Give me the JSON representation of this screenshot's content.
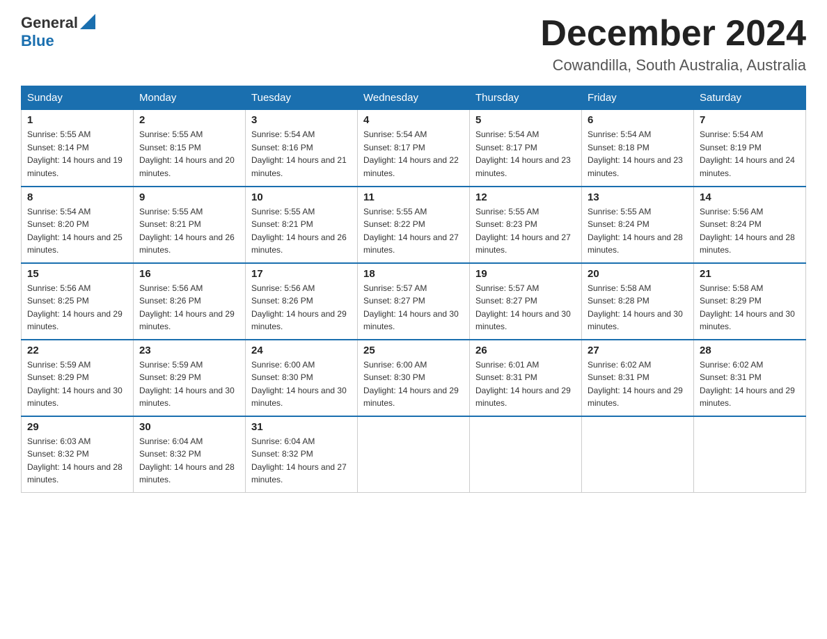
{
  "header": {
    "logo_general": "General",
    "logo_blue": "Blue",
    "month_title": "December 2024",
    "location": "Cowandilla, South Australia, Australia"
  },
  "weekdays": [
    "Sunday",
    "Monday",
    "Tuesday",
    "Wednesday",
    "Thursday",
    "Friday",
    "Saturday"
  ],
  "weeks": [
    [
      {
        "day": "1",
        "sunrise": "5:55 AM",
        "sunset": "8:14 PM",
        "daylight": "14 hours and 19 minutes."
      },
      {
        "day": "2",
        "sunrise": "5:55 AM",
        "sunset": "8:15 PM",
        "daylight": "14 hours and 20 minutes."
      },
      {
        "day": "3",
        "sunrise": "5:54 AM",
        "sunset": "8:16 PM",
        "daylight": "14 hours and 21 minutes."
      },
      {
        "day": "4",
        "sunrise": "5:54 AM",
        "sunset": "8:17 PM",
        "daylight": "14 hours and 22 minutes."
      },
      {
        "day": "5",
        "sunrise": "5:54 AM",
        "sunset": "8:17 PM",
        "daylight": "14 hours and 23 minutes."
      },
      {
        "day": "6",
        "sunrise": "5:54 AM",
        "sunset": "8:18 PM",
        "daylight": "14 hours and 23 minutes."
      },
      {
        "day": "7",
        "sunrise": "5:54 AM",
        "sunset": "8:19 PM",
        "daylight": "14 hours and 24 minutes."
      }
    ],
    [
      {
        "day": "8",
        "sunrise": "5:54 AM",
        "sunset": "8:20 PM",
        "daylight": "14 hours and 25 minutes."
      },
      {
        "day": "9",
        "sunrise": "5:55 AM",
        "sunset": "8:21 PM",
        "daylight": "14 hours and 26 minutes."
      },
      {
        "day": "10",
        "sunrise": "5:55 AM",
        "sunset": "8:21 PM",
        "daylight": "14 hours and 26 minutes."
      },
      {
        "day": "11",
        "sunrise": "5:55 AM",
        "sunset": "8:22 PM",
        "daylight": "14 hours and 27 minutes."
      },
      {
        "day": "12",
        "sunrise": "5:55 AM",
        "sunset": "8:23 PM",
        "daylight": "14 hours and 27 minutes."
      },
      {
        "day": "13",
        "sunrise": "5:55 AM",
        "sunset": "8:24 PM",
        "daylight": "14 hours and 28 minutes."
      },
      {
        "day": "14",
        "sunrise": "5:56 AM",
        "sunset": "8:24 PM",
        "daylight": "14 hours and 28 minutes."
      }
    ],
    [
      {
        "day": "15",
        "sunrise": "5:56 AM",
        "sunset": "8:25 PM",
        "daylight": "14 hours and 29 minutes."
      },
      {
        "day": "16",
        "sunrise": "5:56 AM",
        "sunset": "8:26 PM",
        "daylight": "14 hours and 29 minutes."
      },
      {
        "day": "17",
        "sunrise": "5:56 AM",
        "sunset": "8:26 PM",
        "daylight": "14 hours and 29 minutes."
      },
      {
        "day": "18",
        "sunrise": "5:57 AM",
        "sunset": "8:27 PM",
        "daylight": "14 hours and 30 minutes."
      },
      {
        "day": "19",
        "sunrise": "5:57 AM",
        "sunset": "8:27 PM",
        "daylight": "14 hours and 30 minutes."
      },
      {
        "day": "20",
        "sunrise": "5:58 AM",
        "sunset": "8:28 PM",
        "daylight": "14 hours and 30 minutes."
      },
      {
        "day": "21",
        "sunrise": "5:58 AM",
        "sunset": "8:29 PM",
        "daylight": "14 hours and 30 minutes."
      }
    ],
    [
      {
        "day": "22",
        "sunrise": "5:59 AM",
        "sunset": "8:29 PM",
        "daylight": "14 hours and 30 minutes."
      },
      {
        "day": "23",
        "sunrise": "5:59 AM",
        "sunset": "8:29 PM",
        "daylight": "14 hours and 30 minutes."
      },
      {
        "day": "24",
        "sunrise": "6:00 AM",
        "sunset": "8:30 PM",
        "daylight": "14 hours and 30 minutes."
      },
      {
        "day": "25",
        "sunrise": "6:00 AM",
        "sunset": "8:30 PM",
        "daylight": "14 hours and 29 minutes."
      },
      {
        "day": "26",
        "sunrise": "6:01 AM",
        "sunset": "8:31 PM",
        "daylight": "14 hours and 29 minutes."
      },
      {
        "day": "27",
        "sunrise": "6:02 AM",
        "sunset": "8:31 PM",
        "daylight": "14 hours and 29 minutes."
      },
      {
        "day": "28",
        "sunrise": "6:02 AM",
        "sunset": "8:31 PM",
        "daylight": "14 hours and 29 minutes."
      }
    ],
    [
      {
        "day": "29",
        "sunrise": "6:03 AM",
        "sunset": "8:32 PM",
        "daylight": "14 hours and 28 minutes."
      },
      {
        "day": "30",
        "sunrise": "6:04 AM",
        "sunset": "8:32 PM",
        "daylight": "14 hours and 28 minutes."
      },
      {
        "day": "31",
        "sunrise": "6:04 AM",
        "sunset": "8:32 PM",
        "daylight": "14 hours and 27 minutes."
      },
      null,
      null,
      null,
      null
    ]
  ]
}
